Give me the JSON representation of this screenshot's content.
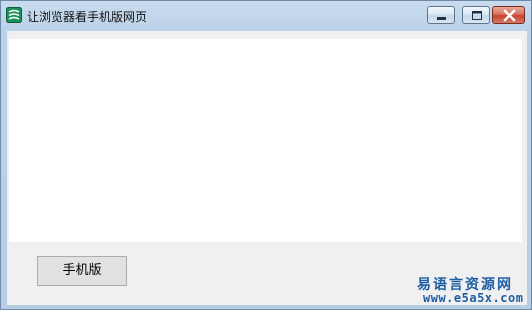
{
  "window": {
    "title": "让浏览器看手机版网页",
    "icon": "app-icon"
  },
  "controls": {
    "minimize_icon": "minimize-icon",
    "maximize_icon": "maximize-icon",
    "close_icon": "close-icon"
  },
  "main": {
    "button_label": "手机版"
  },
  "watermark": {
    "site_name": "易语言资源网",
    "url": "www.e5a5x.com"
  },
  "colors": {
    "title_bar": "#bcd2e9",
    "close_button": "#c4442f",
    "watermark": "#1f5ea3"
  }
}
